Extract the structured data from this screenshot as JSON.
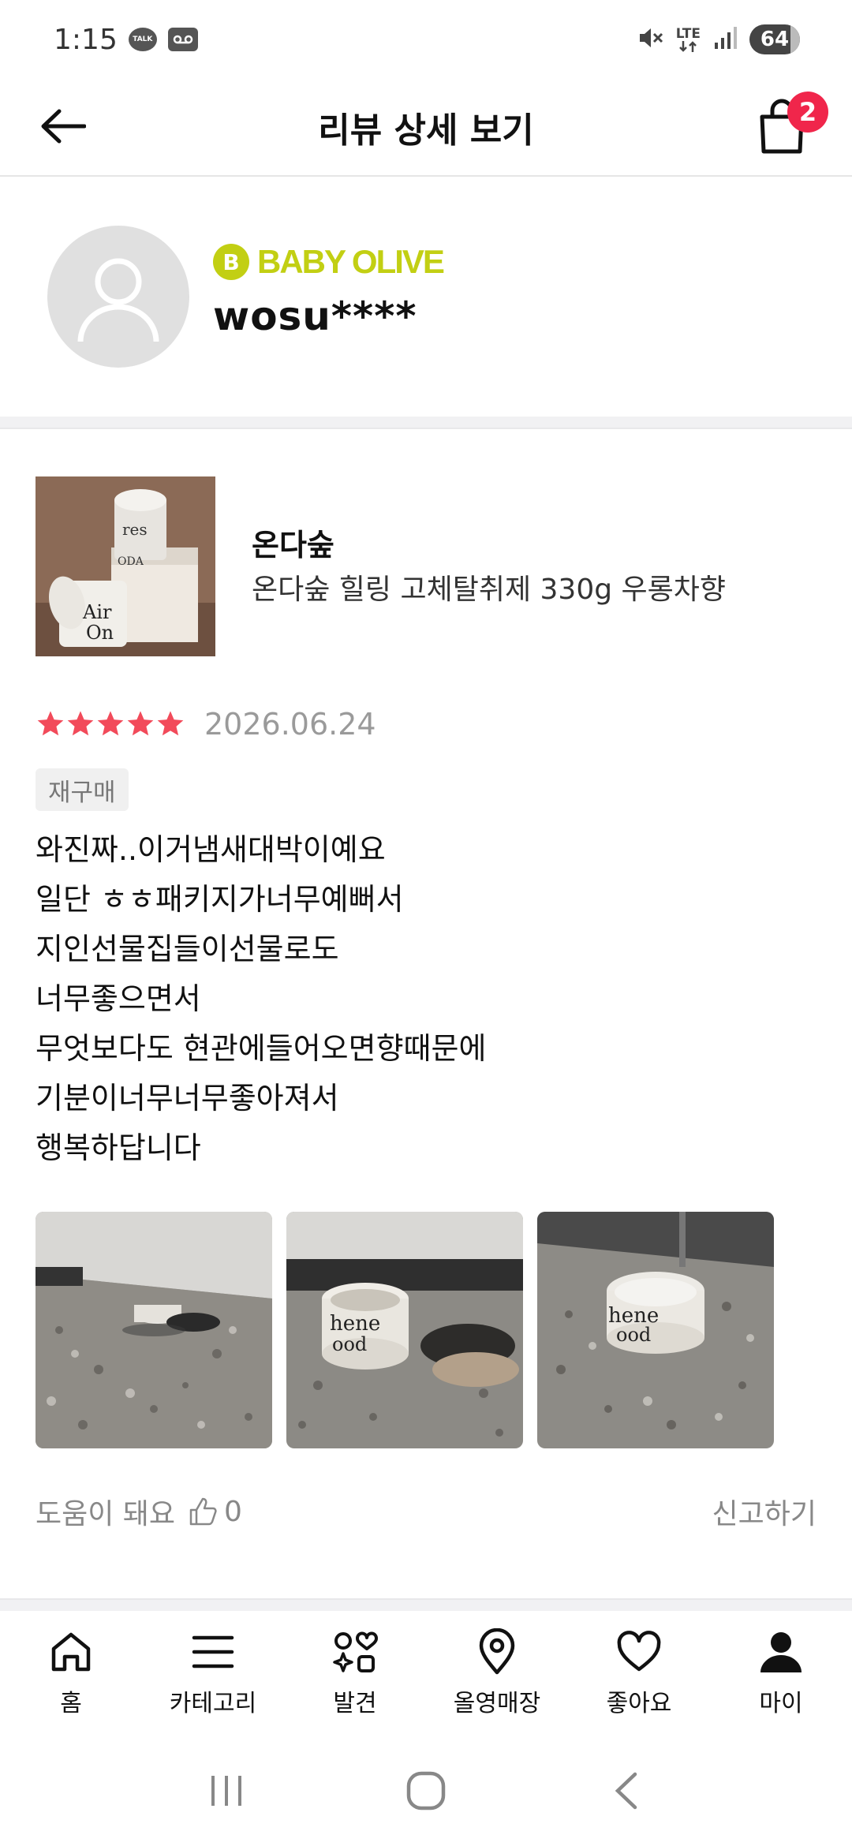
{
  "status_bar": {
    "time": "1:15",
    "talk_label": "TALK",
    "network": "LTE",
    "battery": "64"
  },
  "header": {
    "title": "리뷰 상세 보기",
    "cart_count": "2"
  },
  "profile": {
    "grade_letter": "B",
    "grade_name": "BABY OLIVE",
    "grade_color": "#c2cf13",
    "username": "wosu****"
  },
  "product": {
    "brand": "온다숲",
    "name": "온다숲 힐링 고체탈취제 330g 우롱차향"
  },
  "review": {
    "rating": 5,
    "star_color": "#f24a5a",
    "date": "2026.06.24",
    "badge": "재구매",
    "lines": [
      "와진짜..이거냄새대박이예요",
      "일단 ㅎㅎ패키지가너무예뻐서",
      "지인선물집들이선물로도",
      "너무좋으면서",
      "무엇보다도 현관에들어오면향때문에",
      "기분이너무너무좋아져서",
      "행복하답니다"
    ]
  },
  "feedback": {
    "helpful_label": "도움이 돼요",
    "helpful_count": "0",
    "report_label": "신고하기"
  },
  "bottom_nav": {
    "items": [
      {
        "label": "홈",
        "icon": "home-icon"
      },
      {
        "label": "카테고리",
        "icon": "menu-icon"
      },
      {
        "label": "발견",
        "icon": "discover-icon"
      },
      {
        "label": "올영매장",
        "icon": "location-pin-icon"
      },
      {
        "label": "좋아요",
        "icon": "heart-icon"
      },
      {
        "label": "마이",
        "icon": "person-icon"
      }
    ]
  },
  "colors": {
    "badge_red": "#f0264b",
    "text_gray": "#888888"
  }
}
